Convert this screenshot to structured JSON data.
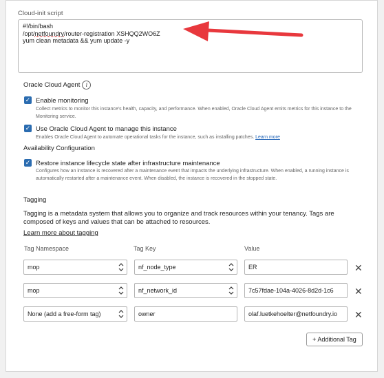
{
  "cloud_init": {
    "label": "Cloud-init script",
    "line1": "#!/bin/bash",
    "line2_prefix": "/opt/",
    "line2_underlined": "netfoundry",
    "line2_suffix": "/router-registration XSHQQ2WO6Z",
    "line3": "yum clean metadata && yum update -y"
  },
  "agent": {
    "title": "Oracle Cloud Agent",
    "info_glyph": "i",
    "monitoring": {
      "title": "Enable monitoring",
      "desc": "Collect metrics to monitor this instance's health, capacity, and performance. When enabled, Oracle Cloud Agent emits metrics for this instance to the Monitoring service.",
      "checked": true
    },
    "manage": {
      "title": "Use Oracle Cloud Agent to manage this instance",
      "desc": "Enables Oracle Cloud Agent to automate operational tasks for the instance, such as installing patches.",
      "link": "Learn more",
      "checked": true
    }
  },
  "availability": {
    "title": "Availability Configuration",
    "restore": {
      "title": "Restore instance lifecycle state after infrastructure maintenance",
      "desc": "Configures how an instance is recovered after a maintenance event that impacts the underlying infrastructure. When enabled, a running instance is automatically restarted after a maintenance event. When disabled, the instance is recovered in the stopped state.",
      "checked": true
    }
  },
  "tagging": {
    "title": "Tagging",
    "description": "Tagging is a metadata system that allows you to organize and track resources within your tenancy. Tags are composed of keys and values that can be attached to resources.",
    "learn_link": "Learn more about tagging",
    "col_namespace": "Tag Namespace",
    "col_key": "Tag Key",
    "col_value": "Value",
    "rows": [
      {
        "namespace": "mop",
        "key": "nf_node_type",
        "value": "ER"
      },
      {
        "namespace": "mop",
        "key": "nf_network_id",
        "value": "7c57fdae-104a-4026-8d2d-1c6"
      },
      {
        "namespace": "None (add a free-form tag)",
        "key": "owner",
        "value": "olaf.luetkehoelter@netfoundry.io"
      }
    ],
    "remove_glyph": "✕",
    "add_button": "+ Additional Tag"
  },
  "annotation": {
    "arrow_color": "#e8383d"
  }
}
